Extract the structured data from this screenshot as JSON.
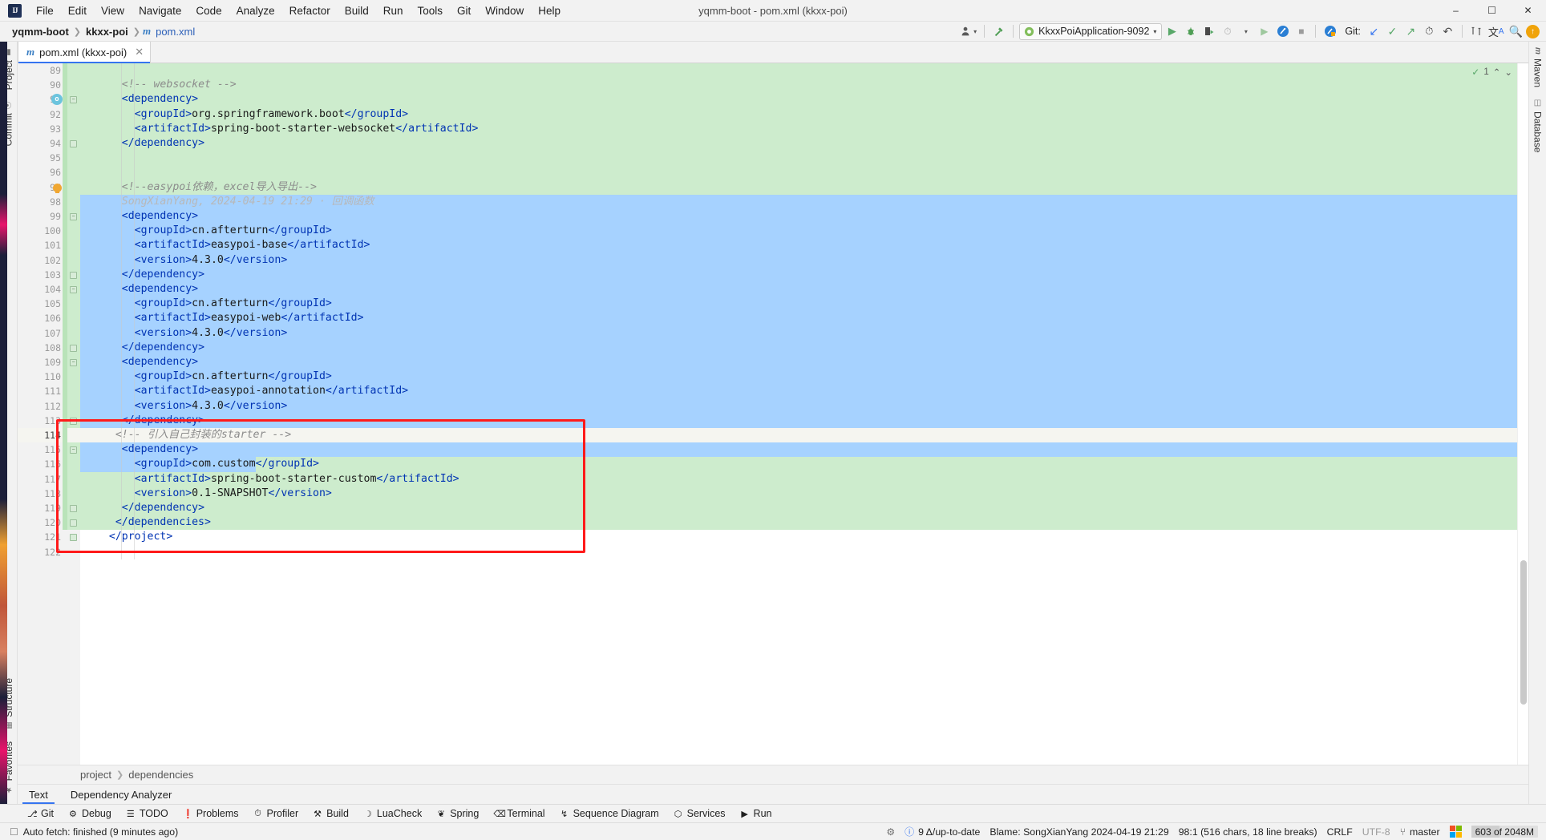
{
  "window": {
    "title": "yqmm-boot - pom.xml (kkxx-poi)",
    "logo": "IJ",
    "minimize": "–",
    "maximize": "☐",
    "close": "✕"
  },
  "menubar": [
    {
      "label": "File"
    },
    {
      "label": "Edit"
    },
    {
      "label": "View"
    },
    {
      "label": "Navigate"
    },
    {
      "label": "Code"
    },
    {
      "label": "Analyze"
    },
    {
      "label": "Refactor"
    },
    {
      "label": "Build"
    },
    {
      "label": "Run"
    },
    {
      "label": "Tools"
    },
    {
      "label": "Git"
    },
    {
      "label": "Window"
    },
    {
      "label": "Help"
    }
  ],
  "navbar": {
    "crumbs": [
      "yqmm-boot",
      "kkxx-poi",
      "pom.xml"
    ],
    "file_icon": "maven-m-icon",
    "run_config": "KkxxPoiApplication-9092",
    "git_label": "Git:"
  },
  "toolbar_icons": [
    {
      "name": "settings-sync-icon",
      "glyph": "♟"
    },
    {
      "name": "hammer-build-icon",
      "glyph": "⚒"
    },
    {
      "name": "run-icon",
      "glyph": "▶"
    },
    {
      "name": "debug-icon",
      "glyph": "⚙"
    },
    {
      "name": "run-with-coverage-icon",
      "glyph": "▶"
    },
    {
      "name": "profiler-icon",
      "glyph": "⏱"
    },
    {
      "name": "stop-icon",
      "glyph": "■"
    },
    {
      "name": "update-project-icon",
      "glyph": "↙"
    },
    {
      "name": "commit-icon",
      "glyph": "✓"
    },
    {
      "name": "push-icon",
      "glyph": "↗"
    },
    {
      "name": "history-icon",
      "glyph": "◴"
    },
    {
      "name": "rollback-icon",
      "glyph": "↶"
    },
    {
      "name": "diff-icon",
      "glyph": "↔"
    },
    {
      "name": "translate-icon",
      "glyph": "文"
    },
    {
      "name": "search-everywhere-icon",
      "glyph": "⚲"
    }
  ],
  "left_stripe": {
    "top": [
      {
        "label": "Project",
        "icon": "folder-icon"
      },
      {
        "label": "Commit",
        "icon": "commit-icon"
      }
    ],
    "bottom": [
      {
        "label": "Structure",
        "icon": "structure-icon"
      },
      {
        "label": "Favorites",
        "icon": "star-icon"
      }
    ]
  },
  "right_stripe": {
    "top": [
      {
        "label": "Maven",
        "icon": "maven-icon"
      },
      {
        "label": "Database",
        "icon": "database-icon"
      }
    ]
  },
  "editor": {
    "tab": {
      "label": "pom.xml (kkxx-poi)",
      "icon": "maven-m-icon",
      "close": "✕"
    },
    "inspection": {
      "count": "1",
      "ok_glyph": "✓",
      "up_glyph": "⌃",
      "down_glyph": "⌄"
    },
    "first_line": 89,
    "lines": [
      {
        "n": 89,
        "indent": 0,
        "bg": "added",
        "parts": []
      },
      {
        "n": 90,
        "indent": 4,
        "bg": "added",
        "parts": [
          {
            "c": "cmt",
            "t": "<!-- websocket -->"
          }
        ]
      },
      {
        "n": 91,
        "indent": 4,
        "bg": "added",
        "parts": [
          {
            "c": "tagb",
            "t": "<dependency>"
          }
        ],
        "gutter": "run-mark",
        "fold": "collapse"
      },
      {
        "n": 92,
        "indent": 6,
        "bg": "added",
        "parts": [
          {
            "c": "tagb",
            "t": "<groupId>"
          },
          {
            "c": "txt",
            "t": "org.springframework.boot"
          },
          {
            "c": "tagb",
            "t": "</groupId>"
          }
        ]
      },
      {
        "n": 93,
        "indent": 6,
        "bg": "added",
        "parts": [
          {
            "c": "tagb",
            "t": "<artifactId>"
          },
          {
            "c": "txt",
            "t": "spring-boot-starter-websocket"
          },
          {
            "c": "tagb",
            "t": "</artifactId>"
          }
        ]
      },
      {
        "n": 94,
        "indent": 4,
        "bg": "added",
        "parts": [
          {
            "c": "tagb",
            "t": "</dependency>"
          }
        ],
        "fold": "end"
      },
      {
        "n": 95,
        "indent": 0,
        "bg": "added",
        "parts": []
      },
      {
        "n": 96,
        "indent": 0,
        "bg": "added",
        "parts": []
      },
      {
        "n": 97,
        "indent": 4,
        "bg": "added",
        "parts": [
          {
            "c": "cmt",
            "t": "<!--easypoi依赖，excel导入导出-->"
          }
        ],
        "gutter": "bulb"
      },
      {
        "n": 98,
        "indent": 4,
        "bg": "sel",
        "lineinfo": true,
        "parts": [
          {
            "c": "blame",
            "t": "SongXianYang, 2024-04-19 21:29 · 回调函数"
          }
        ]
      },
      {
        "n": 99,
        "indent": 4,
        "bg": "sel",
        "parts": [
          {
            "c": "tagb",
            "t": "<dependency>"
          }
        ],
        "fold": "collapse"
      },
      {
        "n": 100,
        "indent": 6,
        "bg": "sel",
        "parts": [
          {
            "c": "tagb",
            "t": "<groupId>"
          },
          {
            "c": "txt",
            "t": "cn.afterturn"
          },
          {
            "c": "tagb",
            "t": "</groupId>"
          }
        ]
      },
      {
        "n": 101,
        "indent": 6,
        "bg": "sel",
        "parts": [
          {
            "c": "tagb",
            "t": "<artifactId>"
          },
          {
            "c": "txt",
            "t": "easypoi-base"
          },
          {
            "c": "tagb",
            "t": "</artifactId>"
          }
        ]
      },
      {
        "n": 102,
        "indent": 6,
        "bg": "sel",
        "parts": [
          {
            "c": "tagb",
            "t": "<version>"
          },
          {
            "c": "txt",
            "t": "4.3.0"
          },
          {
            "c": "tagb",
            "t": "</version>"
          }
        ]
      },
      {
        "n": 103,
        "indent": 4,
        "bg": "sel",
        "parts": [
          {
            "c": "tagb",
            "t": "</dependency>"
          }
        ],
        "fold": "end"
      },
      {
        "n": 104,
        "indent": 4,
        "bg": "sel",
        "parts": [
          {
            "c": "tagb",
            "t": "<dependency>"
          }
        ],
        "fold": "collapse"
      },
      {
        "n": 105,
        "indent": 6,
        "bg": "sel",
        "parts": [
          {
            "c": "tagb",
            "t": "<groupId>"
          },
          {
            "c": "txt",
            "t": "cn.afterturn"
          },
          {
            "c": "tagb",
            "t": "</groupId>"
          }
        ]
      },
      {
        "n": 106,
        "indent": 6,
        "bg": "sel",
        "parts": [
          {
            "c": "tagb",
            "t": "<artifactId>"
          },
          {
            "c": "txt",
            "t": "easypoi-web"
          },
          {
            "c": "tagb",
            "t": "</artifactId>"
          }
        ]
      },
      {
        "n": 107,
        "indent": 6,
        "bg": "sel",
        "parts": [
          {
            "c": "tagb",
            "t": "<version>"
          },
          {
            "c": "txt",
            "t": "4.3.0"
          },
          {
            "c": "tagb",
            "t": "</version>"
          }
        ]
      },
      {
        "n": 108,
        "indent": 4,
        "bg": "sel",
        "parts": [
          {
            "c": "tagb",
            "t": "</dependency>"
          }
        ],
        "fold": "end"
      },
      {
        "n": 109,
        "indent": 4,
        "bg": "sel",
        "parts": [
          {
            "c": "tagb",
            "t": "<dependency>"
          }
        ],
        "fold": "collapse"
      },
      {
        "n": 110,
        "indent": 6,
        "bg": "sel",
        "parts": [
          {
            "c": "tagb",
            "t": "<groupId>"
          },
          {
            "c": "txt",
            "t": "cn.afterturn"
          },
          {
            "c": "tagb",
            "t": "</groupId>"
          }
        ]
      },
      {
        "n": 111,
        "indent": 6,
        "bg": "sel",
        "parts": [
          {
            "c": "tagb",
            "t": "<artifactId>"
          },
          {
            "c": "txt",
            "t": "easypoi-annotation"
          },
          {
            "c": "tagb",
            "t": "</artifactId>"
          }
        ]
      },
      {
        "n": 112,
        "indent": 6,
        "bg": "sel",
        "parts": [
          {
            "c": "tagb",
            "t": "<version>"
          },
          {
            "c": "txt",
            "t": "4.3.0"
          },
          {
            "c": "tagb",
            "t": "</version>"
          }
        ]
      },
      {
        "n": 113,
        "indent": 4,
        "bg": "sel",
        "parts": [
          {
            "c": "tagb",
            "t": "</dependency>"
          }
        ],
        "fold": "end"
      },
      {
        "n": 114,
        "indent": 3,
        "bg": "caret",
        "parts": [
          {
            "c": "cmt",
            "t": "<!-- 引入自己封装的starter -->"
          }
        ]
      },
      {
        "n": 115,
        "indent": 4,
        "bg": "sel",
        "parts": [
          {
            "c": "tagb",
            "t": "<dependency>"
          }
        ],
        "fold": "collapse"
      },
      {
        "n": 116,
        "indent": 6,
        "bg": "sel-partial",
        "parts": [
          {
            "c": "tagb",
            "t": "<groupId>"
          },
          {
            "c": "txt",
            "t": "com.custom"
          },
          {
            "c": "tagb",
            "t": "</groupId>"
          }
        ]
      },
      {
        "n": 117,
        "indent": 6,
        "bg": "added",
        "parts": [
          {
            "c": "tagb",
            "t": "<artifactId>"
          },
          {
            "c": "txt",
            "t": "spring-boot-starter-custom"
          },
          {
            "c": "tagb",
            "t": "</artifactId>"
          }
        ]
      },
      {
        "n": 118,
        "indent": 6,
        "bg": "added",
        "parts": [
          {
            "c": "tagb",
            "t": "<version>"
          },
          {
            "c": "txt",
            "t": "0.1-SNAPSHOT"
          },
          {
            "c": "tagb",
            "t": "</version>"
          }
        ]
      },
      {
        "n": 119,
        "indent": 4,
        "bg": "added",
        "parts": [
          {
            "c": "tagb",
            "t": "</dependency>"
          }
        ],
        "fold": "end"
      },
      {
        "n": 120,
        "indent": 3,
        "bg": "added",
        "parts": [
          {
            "c": "tagb",
            "t": "</dependencies>"
          }
        ],
        "fold": "end"
      },
      {
        "n": 121,
        "indent": 2,
        "bg": "none",
        "parts": [
          {
            "c": "tagb",
            "t": "</project>"
          }
        ],
        "fold": "end"
      },
      {
        "n": 122,
        "indent": 0,
        "bg": "none",
        "parts": []
      }
    ],
    "breadcrumb": [
      "project",
      "dependencies"
    ],
    "bottom_tabs": [
      {
        "label": "Text",
        "active": true
      },
      {
        "label": "Dependency Analyzer",
        "active": false
      }
    ]
  },
  "tool_window_bar": [
    {
      "label": "Git",
      "icon": "git-branch-icon",
      "glyph": "⎇"
    },
    {
      "label": "Debug",
      "icon": "debug-bug-icon",
      "glyph": "⚙"
    },
    {
      "label": "TODO",
      "icon": "todo-list-icon",
      "glyph": "☰"
    },
    {
      "label": "Problems",
      "icon": "problems-icon",
      "glyph": "❗"
    },
    {
      "label": "Profiler",
      "icon": "profiler-icon",
      "glyph": "⏱"
    },
    {
      "label": "Build",
      "icon": "hammer-icon",
      "glyph": "⚒"
    },
    {
      "label": "LuaCheck",
      "icon": "luacheck-moon-icon",
      "glyph": "☽"
    },
    {
      "label": "Spring",
      "icon": "spring-leaf-icon",
      "glyph": "❦"
    },
    {
      "label": "Terminal",
      "icon": "terminal-icon",
      "glyph": "⌫"
    },
    {
      "label": "Sequence Diagram",
      "icon": "sequence-diagram-icon",
      "glyph": "↯"
    },
    {
      "label": "Services",
      "icon": "services-icon",
      "glyph": "⬡"
    },
    {
      "label": "Run",
      "icon": "run-icon",
      "glyph": "▶"
    }
  ],
  "status_bar": {
    "left_icon": "notification-icon",
    "message": "Auto fetch: finished (9 minutes ago)",
    "inspections_icon": "inspection-profile-icon",
    "problems": "9 Δ/up-to-date",
    "blame": "Blame: SongXianYang 2024-04-19 21:29",
    "caret": "98:1 (516 chars, 18 line breaks)",
    "line_sep": "CRLF",
    "encoding": "UTF-8",
    "branch": "master",
    "branch_icon": "git-branch-icon",
    "memory": "603 of 2048M",
    "memory_used": "603",
    "memory_total": "of 2048M"
  },
  "colors": {
    "accent": "#3574f0",
    "diff_added": "#cdeccd",
    "selection": "#a6d2ff",
    "annotation_box": "#ff1a1a",
    "tag": "#0033b3",
    "comment": "#8c8c8c"
  }
}
